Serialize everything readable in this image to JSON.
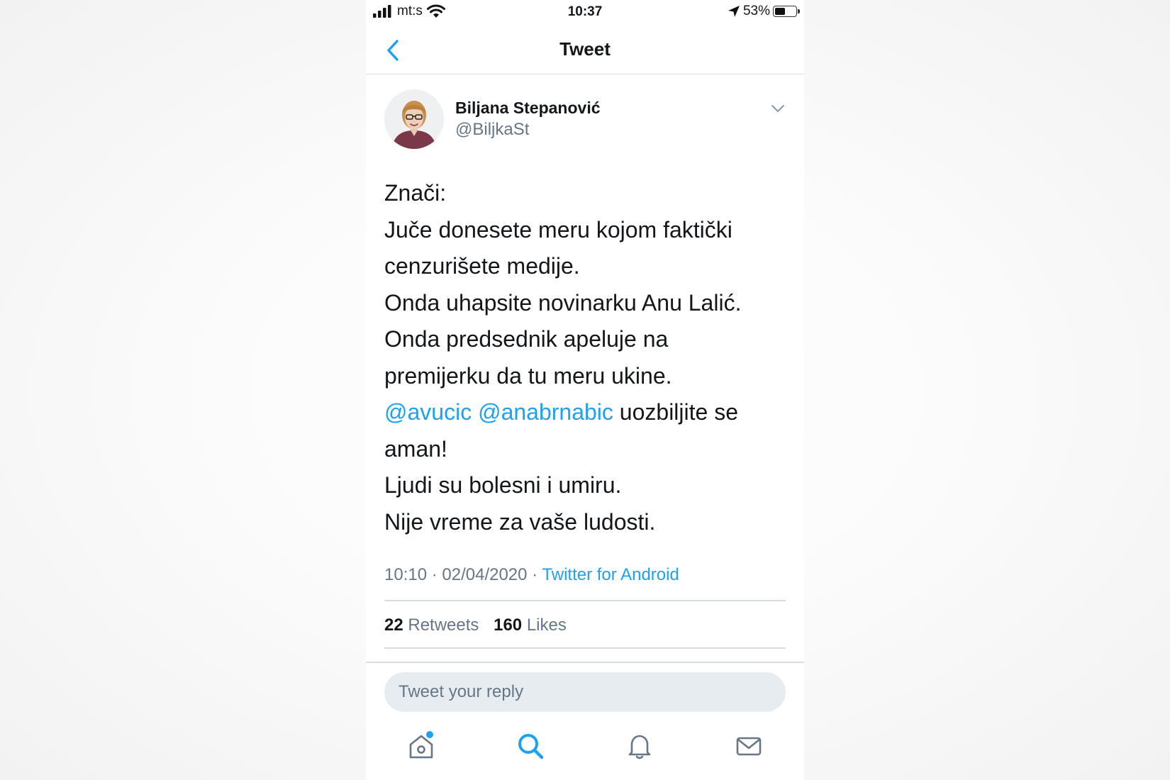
{
  "status_bar": {
    "carrier": "mt:s",
    "time": "10:37",
    "battery_percent": "53%",
    "battery_level": 0.53
  },
  "nav": {
    "title": "Tweet",
    "back_icon": "chevron-left-icon"
  },
  "tweet": {
    "author_name": "Biljana Stepanović",
    "author_handle": "@BiljkaSt",
    "lines": {
      "l1": "Znači:",
      "l2": "Juče donesete meru kojom faktički",
      "l3": "cenzurišete medije.",
      "l4": "Onda uhapsite novinarku Anu Lalić.",
      "l5": "Onda predsednik apeluje na",
      "l6": "premijerku da tu meru ukine.",
      "mention1": "@avucic",
      "mention2": "@anabrnabic",
      "l7_rest": " uozbiljite se",
      "l8": "aman!",
      "l9": "Ljudi su bolesni i umiru.",
      "l10": "Nije vreme za vaše ludosti."
    },
    "timestamp": "10:10 · 02/04/2020 · ",
    "source": "Twitter for Android",
    "retweets_count": "22",
    "retweets_label": "Retweets",
    "likes_count": "160",
    "likes_label": "Likes"
  },
  "reply": {
    "placeholder": "Tweet your reply"
  },
  "tabbar": {
    "items": [
      "home-icon",
      "search-icon",
      "notifications-icon",
      "messages-icon"
    ],
    "active": "search-icon",
    "active_color": "#1da1f2",
    "inactive_color": "#657786",
    "badge_color": "#1da1f2"
  },
  "colors": {
    "accent": "#1da1f2",
    "text": "#14171a",
    "muted": "#657786"
  }
}
